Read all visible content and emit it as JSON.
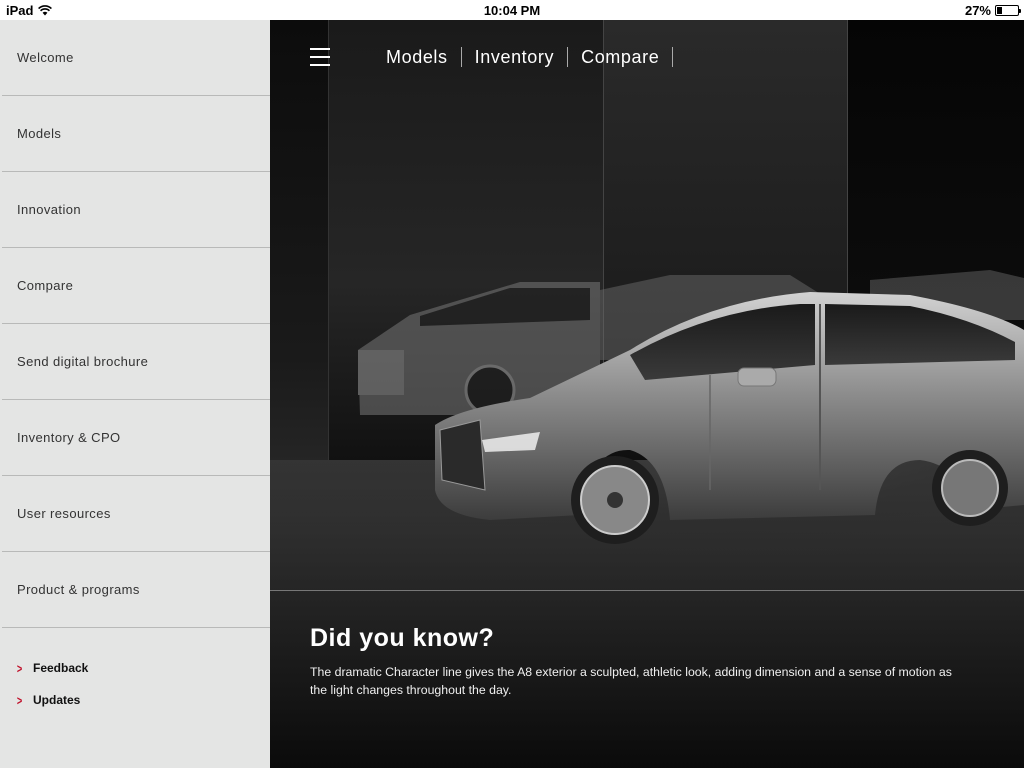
{
  "status_bar": {
    "device": "iPad",
    "time": "10:04 PM",
    "battery": "27%",
    "battery_level": 0.27
  },
  "sidebar": {
    "items": [
      {
        "label": "Welcome"
      },
      {
        "label": "Models"
      },
      {
        "label": "Innovation"
      },
      {
        "label": "Compare"
      },
      {
        "label": "Send digital brochure"
      },
      {
        "label": "Inventory & CPO"
      },
      {
        "label": "User resources"
      },
      {
        "label": "Product & programs"
      }
    ],
    "links": [
      {
        "label": "Feedback"
      },
      {
        "label": "Updates"
      }
    ]
  },
  "topnav": {
    "items": [
      {
        "label": "Models"
      },
      {
        "label": "Inventory"
      },
      {
        "label": "Compare"
      }
    ]
  },
  "info": {
    "title": "Did you know?",
    "body": "The dramatic Character line gives the A8 exterior a sculpted, athletic look, adding dimension and a sense of motion as the light changes throughout the day."
  },
  "colors": {
    "accent": "#c0102a",
    "sidebar_bg": "#e4e5e4"
  },
  "icons": {
    "menu": "hamburger-icon",
    "chevron": "chevron-right-icon",
    "wifi": "wifi-icon",
    "battery": "battery-icon"
  }
}
